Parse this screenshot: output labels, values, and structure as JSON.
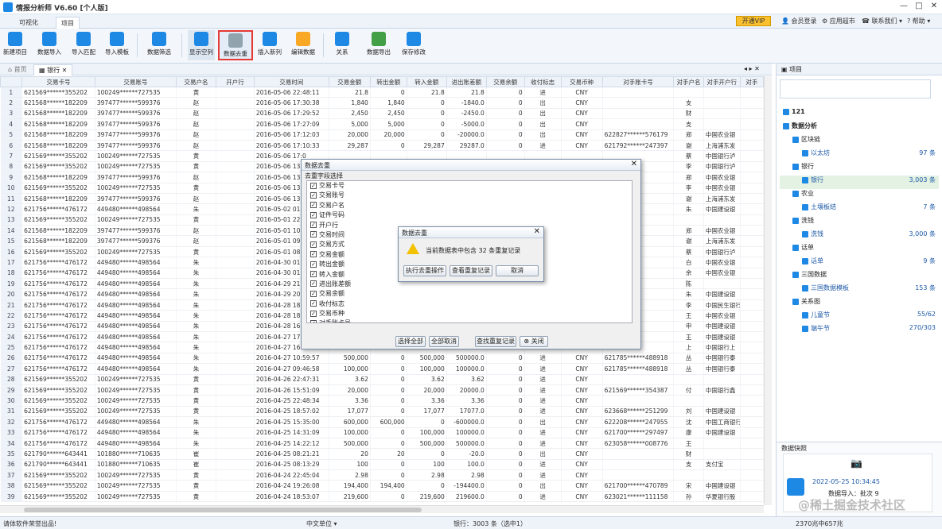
{
  "app": {
    "title": "情报分析师 V6.60 [个人版]"
  },
  "window_controls": {
    "min": "—",
    "max": "□",
    "close": "✕"
  },
  "tabs": [
    {
      "label": "可视化"
    },
    {
      "label": "项目"
    }
  ],
  "top_right": {
    "vip": "开通VIP",
    "login": "会员登录",
    "apps": "应用超市",
    "contact": "联系我们",
    "help": "帮助"
  },
  "toolbar": [
    {
      "label": "新建项目",
      "icon": "new-project-icon",
      "color": "#1e88e5"
    },
    {
      "label": "数据导入",
      "icon": "import-icon",
      "color": "#1e88e5"
    },
    {
      "label": "导入匹配",
      "icon": "match-icon",
      "color": "#1e88e5"
    },
    {
      "label": "导入模板",
      "icon": "template-icon",
      "color": "#1e88e5"
    },
    {
      "label": "数据筛选",
      "icon": "filter-icon",
      "color": "#1e88e5"
    },
    {
      "label": "显示空列",
      "icon": "show-empty-icon",
      "color": "#1e88e5"
    },
    {
      "label": "数据去重",
      "icon": "dedupe-icon",
      "color": "#90a4ae"
    },
    {
      "label": "插入新列",
      "icon": "insert-column-icon",
      "color": "#1e88e5"
    },
    {
      "label": "编辑数据",
      "icon": "edit-icon",
      "color": "#f9a825"
    },
    {
      "label": "关系",
      "icon": "relation-icon",
      "color": "#1e88e5"
    },
    {
      "label": "数据导出",
      "icon": "export-icon",
      "color": "#43a047"
    },
    {
      "label": "保存修改",
      "icon": "save-icon",
      "color": "#1e88e5"
    }
  ],
  "doc_tabs": [
    {
      "label": "首页"
    },
    {
      "label": "银行"
    }
  ],
  "columns": [
    "交易卡号",
    "交易账号",
    "交易户名",
    "开户行",
    "交易时间",
    "交易金额",
    "转出金额",
    "转入金额",
    "进出账差额",
    "交易余额",
    "收付标志",
    "交易币种",
    "对手账卡号",
    "对手户名",
    "对手开户行",
    "对手"
  ],
  "rows": [
    {
      "n": "1",
      "card": "621569******355202",
      "acct": "100249******727535",
      "name": "黄",
      "time": "2016-05-06 22:48:11",
      "amt": "21.8",
      "out": "0",
      "in": "21.8",
      "diff": "21.8",
      "bal": "0",
      "flag": "进",
      "cur": "CNY",
      "peer": "",
      "pname": "",
      "pbank": ""
    },
    {
      "n": "2",
      "card": "621568******182209",
      "acct": "397477******599376",
      "name": "赵",
      "time": "2016-05-06 17:30:38",
      "amt": "1,840",
      "out": "1,840",
      "in": "0",
      "diff": "-1840.0",
      "bal": "0",
      "flag": "出",
      "cur": "CNY",
      "peer": "",
      "pname": "支",
      "pbank": ""
    },
    {
      "n": "3",
      "card": "621568******182209",
      "acct": "397477******599376",
      "name": "赵",
      "time": "2016-05-06 17:29:52",
      "amt": "2,450",
      "out": "2,450",
      "in": "0",
      "diff": "-2450.0",
      "bal": "0",
      "flag": "出",
      "cur": "CNY",
      "peer": "",
      "pname": "财",
      "pbank": ""
    },
    {
      "n": "4",
      "card": "621568******182209",
      "acct": "397477******599376",
      "name": "赵",
      "time": "2016-05-06 17:27:09",
      "amt": "5,000",
      "out": "5,000",
      "in": "0",
      "diff": "-5000.0",
      "bal": "0",
      "flag": "出",
      "cur": "CNY",
      "peer": "",
      "pname": "支",
      "pbank": ""
    },
    {
      "n": "5",
      "card": "621568******182209",
      "acct": "397477******599376",
      "name": "赵",
      "time": "2016-05-06 17:12:03",
      "amt": "20,000",
      "out": "20,000",
      "in": "0",
      "diff": "-20000.0",
      "bal": "0",
      "flag": "出",
      "cur": "CNY",
      "peer": "622827******576179",
      "pname": "郑",
      "pbank": "中国农业银"
    },
    {
      "n": "6",
      "card": "621568******182209",
      "acct": "397477******599376",
      "name": "赵",
      "time": "2016-05-06 17:10:33",
      "amt": "29,287",
      "out": "0",
      "in": "29,287",
      "diff": "29287.0",
      "bal": "0",
      "flag": "进",
      "cur": "CNY",
      "peer": "621792******247397",
      "pname": "谢",
      "pbank": "上海浦东发"
    },
    {
      "n": "7",
      "card": "621569******355202",
      "acct": "100249******727535",
      "name": "黄",
      "time": "2016-05-06 17:0",
      "amt": "",
      "out": "",
      "in": "",
      "diff": "",
      "bal": "",
      "flag": "",
      "cur": "",
      "peer": "",
      "pname": "蔡",
      "pbank": "中国银行泸"
    },
    {
      "n": "8",
      "card": "621569******355202",
      "acct": "100249******727535",
      "name": "黄",
      "time": "2016-05-06 13:",
      "amt": "",
      "out": "",
      "in": "",
      "diff": "",
      "bal": "",
      "flag": "",
      "cur": "",
      "peer": "",
      "pname": "李",
      "pbank": "中国银行泸"
    },
    {
      "n": "9",
      "card": "621568******182209",
      "acct": "397477******599376",
      "name": "赵",
      "time": "2016-05-06 13:",
      "amt": "",
      "out": "",
      "in": "",
      "diff": "",
      "bal": "",
      "flag": "",
      "cur": "",
      "peer": "",
      "pname": "郑",
      "pbank": "中国农业银"
    },
    {
      "n": "10",
      "card": "621569******355202",
      "acct": "100249******727535",
      "name": "黄",
      "time": "2016-05-06 13:",
      "amt": "",
      "out": "",
      "in": "",
      "diff": "",
      "bal": "",
      "flag": "",
      "cur": "",
      "peer": "",
      "pname": "李",
      "pbank": "中国农业银"
    },
    {
      "n": "11",
      "card": "621568******182209",
      "acct": "397477******599376",
      "name": "赵",
      "time": "2016-05-06 13:",
      "amt": "",
      "out": "",
      "in": "",
      "diff": "",
      "bal": "",
      "flag": "",
      "cur": "",
      "peer": "",
      "pname": "谢",
      "pbank": "上海浦东发"
    },
    {
      "n": "12",
      "card": "621756******476172",
      "acct": "449480******498564",
      "name": "朱",
      "time": "2016-05-02 01:",
      "amt": "",
      "out": "",
      "in": "",
      "diff": "",
      "bal": "",
      "flag": "",
      "cur": "",
      "peer": "",
      "pname": "朱",
      "pbank": "中国建设银"
    },
    {
      "n": "13",
      "card": "621569******355202",
      "acct": "100249******727535",
      "name": "黄",
      "time": "2016-05-01 22:",
      "amt": "",
      "out": "",
      "in": "",
      "diff": "",
      "bal": "",
      "flag": "",
      "cur": "",
      "peer": "",
      "pname": "",
      "pbank": ""
    },
    {
      "n": "14",
      "card": "621568******182209",
      "acct": "397477******599376",
      "name": "赵",
      "time": "2016-05-01 10:",
      "amt": "",
      "out": "",
      "in": "",
      "diff": "",
      "bal": "",
      "flag": "",
      "cur": "",
      "peer": "",
      "pname": "郑",
      "pbank": "中国农业银"
    },
    {
      "n": "15",
      "card": "621568******182209",
      "acct": "397477******599376",
      "name": "赵",
      "time": "2016-05-01 09:",
      "amt": "",
      "out": "",
      "in": "",
      "diff": "",
      "bal": "",
      "flag": "",
      "cur": "",
      "peer": "",
      "pname": "谢",
      "pbank": "上海浦东发"
    },
    {
      "n": "16",
      "card": "621569******355202",
      "acct": "100249******727535",
      "name": "黄",
      "time": "2016-05-01 08:",
      "amt": "",
      "out": "",
      "in": "",
      "diff": "",
      "bal": "",
      "flag": "",
      "cur": "",
      "peer": "",
      "pname": "蔡",
      "pbank": "中国银行泸"
    },
    {
      "n": "17",
      "card": "621756******476172",
      "acct": "449480******498564",
      "name": "朱",
      "time": "2016-04-30 01:",
      "amt": "",
      "out": "",
      "in": "",
      "diff": "",
      "bal": "",
      "flag": "",
      "cur": "",
      "peer": "",
      "pname": "白",
      "pbank": "中国农业银"
    },
    {
      "n": "18",
      "card": "621756******476172",
      "acct": "449480******498564",
      "name": "朱",
      "time": "2016-04-30 01:",
      "amt": "",
      "out": "",
      "in": "",
      "diff": "",
      "bal": "",
      "flag": "",
      "cur": "",
      "peer": "",
      "pname": "余",
      "pbank": "中国农业银"
    },
    {
      "n": "19",
      "card": "621756******476172",
      "acct": "449480******498564",
      "name": "朱",
      "time": "2016-04-29 21:",
      "amt": "",
      "out": "",
      "in": "",
      "diff": "",
      "bal": "",
      "flag": "",
      "cur": "",
      "peer": "",
      "pname": "陈",
      "pbank": ""
    },
    {
      "n": "20",
      "card": "621756******476172",
      "acct": "449480******498564",
      "name": "朱",
      "time": "2016-04-29 20:",
      "amt": "",
      "out": "",
      "in": "",
      "diff": "",
      "bal": "",
      "flag": "",
      "cur": "",
      "peer": "",
      "pname": "朱",
      "pbank": "中国建设银"
    },
    {
      "n": "21",
      "card": "621756******476172",
      "acct": "449480******498564",
      "name": "朱",
      "time": "2016-04-28 18:",
      "amt": "",
      "out": "",
      "in": "",
      "diff": "",
      "bal": "",
      "flag": "",
      "cur": "",
      "peer": "",
      "pname": "李",
      "pbank": "中国民生银行"
    },
    {
      "n": "22",
      "card": "621756******476172",
      "acct": "449480******498564",
      "name": "朱",
      "time": "2016-04-28 18:",
      "amt": "",
      "out": "",
      "in": "",
      "diff": "",
      "bal": "",
      "flag": "",
      "cur": "",
      "peer": "",
      "pname": "王",
      "pbank": "中国农业银"
    },
    {
      "n": "23",
      "card": "621756******476172",
      "acct": "449480******498564",
      "name": "朱",
      "time": "2016-04-28 16:",
      "amt": "",
      "out": "",
      "in": "",
      "diff": "",
      "bal": "",
      "flag": "",
      "cur": "",
      "peer": "",
      "pname": "申",
      "pbank": "中国建设银"
    },
    {
      "n": "24",
      "card": "621756******476172",
      "acct": "449480******498564",
      "name": "朱",
      "time": "2016-04-27 17:",
      "amt": "",
      "out": "",
      "in": "",
      "diff": "",
      "bal": "",
      "flag": "",
      "cur": "",
      "peer": "",
      "pname": "王",
      "pbank": "中国建设银"
    },
    {
      "n": "25",
      "card": "621756******476172",
      "acct": "449480******498564",
      "name": "朱",
      "time": "2016-04-27 16:",
      "amt": "",
      "out": "",
      "in": "",
      "diff": "",
      "bal": "",
      "flag": "",
      "cur": "",
      "peer": "",
      "pname": "上",
      "pbank": "中国银行上"
    },
    {
      "n": "26",
      "card": "621756******476172",
      "acct": "449480******498564",
      "name": "朱",
      "time": "2016-04-27 10:59:57",
      "amt": "500,000",
      "out": "0",
      "in": "500,000",
      "diff": "500000.0",
      "bal": "0",
      "flag": "进",
      "cur": "CNY",
      "peer": "621785******488918",
      "pname": "丛",
      "pbank": "中国银行泰"
    },
    {
      "n": "27",
      "card": "621756******476172",
      "acct": "449480******498564",
      "name": "朱",
      "time": "2016-04-27 09:46:58",
      "amt": "100,000",
      "out": "0",
      "in": "100,000",
      "diff": "100000.0",
      "bal": "0",
      "flag": "进",
      "cur": "CNY",
      "peer": "621785******488918",
      "pname": "丛",
      "pbank": "中国银行泰"
    },
    {
      "n": "28",
      "card": "621569******355202",
      "acct": "100249******727535",
      "name": "黄",
      "time": "2016-04-26 22:47:31",
      "amt": "3.62",
      "out": "0",
      "in": "3.62",
      "diff": "3.62",
      "bal": "0",
      "flag": "进",
      "cur": "CNY",
      "peer": "",
      "pname": "",
      "pbank": ""
    },
    {
      "n": "29",
      "card": "621569******355202",
      "acct": "100249******727535",
      "name": "黄",
      "time": "2016-04-26 15:51:09",
      "amt": "20,000",
      "out": "0",
      "in": "20,000",
      "diff": "20000.0",
      "bal": "0",
      "flag": "进",
      "cur": "CNY",
      "peer": "621569******354387",
      "pname": "付",
      "pbank": "中国银行鑫"
    },
    {
      "n": "30",
      "card": "621569******355202",
      "acct": "100249******727535",
      "name": "黄",
      "time": "2016-04-25 22:48:34",
      "amt": "3.36",
      "out": "0",
      "in": "3.36",
      "diff": "3.36",
      "bal": "0",
      "flag": "进",
      "cur": "CNY",
      "peer": "",
      "pname": "",
      "pbank": ""
    },
    {
      "n": "31",
      "card": "621569******355202",
      "acct": "100249******727535",
      "name": "黄",
      "time": "2016-04-25 18:57:02",
      "amt": "17,077",
      "out": "0",
      "in": "17,077",
      "diff": "17077.0",
      "bal": "0",
      "flag": "进",
      "cur": "CNY",
      "peer": "623668******251299",
      "pname": "刘",
      "pbank": "中国建设银"
    },
    {
      "n": "32",
      "card": "621756******476172",
      "acct": "449480******498564",
      "name": "朱",
      "time": "2016-04-25 15:35:00",
      "amt": "600,000",
      "out": "600,000",
      "in": "0",
      "diff": "-600000.0",
      "bal": "0",
      "flag": "出",
      "cur": "CNY",
      "peer": "622208******247955",
      "pname": "沈",
      "pbank": "中国工商银行"
    },
    {
      "n": "33",
      "card": "621756******476172",
      "acct": "449480******498564",
      "name": "朱",
      "time": "2016-04-25 14:31:09",
      "amt": "100,000",
      "out": "0",
      "in": "100,000",
      "diff": "100000.0",
      "bal": "0",
      "flag": "进",
      "cur": "CNY",
      "peer": "621700******297497",
      "pname": "康",
      "pbank": "中国建设银"
    },
    {
      "n": "34",
      "card": "621756******476172",
      "acct": "449480******498564",
      "name": "朱",
      "time": "2016-04-25 14:22:12",
      "amt": "500,000",
      "out": "0",
      "in": "500,000",
      "diff": "500000.0",
      "bal": "0",
      "flag": "进",
      "cur": "CNY",
      "peer": "623058******008776",
      "pname": "王",
      "pbank": ""
    },
    {
      "n": "35",
      "card": "621790******643441",
      "acct": "101880******710635",
      "name": "崔",
      "time": "2016-04-25 08:21:21",
      "amt": "20",
      "out": "20",
      "in": "0",
      "diff": "-20.0",
      "bal": "0",
      "flag": "出",
      "cur": "CNY",
      "peer": "",
      "pname": "财",
      "pbank": ""
    },
    {
      "n": "36",
      "card": "621790******643441",
      "acct": "101880******710635",
      "name": "崔",
      "time": "2016-04-25 08:13:29",
      "amt": "100",
      "out": "0",
      "in": "100",
      "diff": "100.0",
      "bal": "0",
      "flag": "进",
      "cur": "CNY",
      "peer": "",
      "pname": "支",
      "pbank": "支付宝"
    },
    {
      "n": "37",
      "card": "621569******355202",
      "acct": "100249******727535",
      "name": "黄",
      "time": "2016-04-24 22:45:04",
      "amt": "2.98",
      "out": "0",
      "in": "2.98",
      "diff": "2.98",
      "bal": "0",
      "flag": "进",
      "cur": "CNY",
      "peer": "",
      "pname": "",
      "pbank": ""
    },
    {
      "n": "38",
      "card": "621569******355202",
      "acct": "100249******727535",
      "name": "黄",
      "time": "2016-04-24 19:26:08",
      "amt": "194,400",
      "out": "194,400",
      "in": "0",
      "diff": "-194400.0",
      "bal": "0",
      "flag": "出",
      "cur": "CNY",
      "peer": "621700******470789",
      "pname": "宋",
      "pbank": "中国建设银"
    },
    {
      "n": "39",
      "card": "621569******355202",
      "acct": "100249******727535",
      "name": "黄",
      "time": "2016-04-24 18:53:07",
      "amt": "219,600",
      "out": "0",
      "in": "219,600",
      "diff": "219600.0",
      "bal": "0",
      "flag": "进",
      "cur": "CNY",
      "peer": "623021******111158",
      "pname": "孙",
      "pbank": "华夏银行股"
    }
  ],
  "dedupe_dialog": {
    "title": "数据去重",
    "section": "去重字段选择",
    "fields": [
      "交易卡号",
      "交易账号",
      "交易户名",
      "证件号码",
      "开户行",
      "交易时间",
      "交易方式",
      "交易金额",
      "转出金额",
      "转入金额",
      "进出账差额",
      "交易余额",
      "收付标志",
      "交易币种",
      "对手账卡号"
    ],
    "buttons": {
      "select_all": "选择全部",
      "clear_all": "全部取消",
      "find": "查找重复记录",
      "close": "关闭"
    }
  },
  "confirm_dialog": {
    "title": "数据去重",
    "message": "当前数据表中包含 32 条重复记录",
    "buttons": {
      "execute": "执行去重操作",
      "view": "查看重复记录",
      "cancel": "取消"
    }
  },
  "right_panel": {
    "title": "项目",
    "tree": [
      {
        "label": "121",
        "count": "",
        "level": 0
      },
      {
        "label": "数据分析",
        "count": "",
        "level": 0
      },
      {
        "label": "区块链",
        "count": "",
        "level": 1
      },
      {
        "label": "以太坊",
        "count": "97 条",
        "level": 2
      },
      {
        "label": "银行",
        "count": "",
        "level": 1
      },
      {
        "label": "银行",
        "count": "3,003 条",
        "level": 2
      },
      {
        "label": "农业",
        "count": "",
        "level": 1
      },
      {
        "label": "土壤板结",
        "count": "7 条",
        "level": 2
      },
      {
        "label": "洗钱",
        "count": "",
        "level": 1
      },
      {
        "label": "洗钱",
        "count": "3,000 条",
        "level": 2
      },
      {
        "label": "话单",
        "count": "",
        "level": 1
      },
      {
        "label": "话单",
        "count": "9 条",
        "level": 2
      },
      {
        "label": "三国数据",
        "count": "",
        "level": 1
      },
      {
        "label": "三国数据模板",
        "count": "153 条",
        "level": 2
      },
      {
        "label": "关系图",
        "count": "",
        "level": 1
      },
      {
        "label": "儿童节",
        "count": "55/62",
        "level": 2
      },
      {
        "label": "端午节",
        "count": "270/303",
        "level": 2
      }
    ],
    "snapshot": {
      "title": "数据快照",
      "time": "2022-05-25 10:34:45",
      "info": "数据导入：批次 9"
    }
  },
  "status": {
    "left": "请体软件荣誉出品!",
    "unit": "中文单位",
    "records": "银行：3003 条（选中1）",
    "stats": "2370兆中657兆"
  },
  "watermark": "@稀土掘金技术社区"
}
